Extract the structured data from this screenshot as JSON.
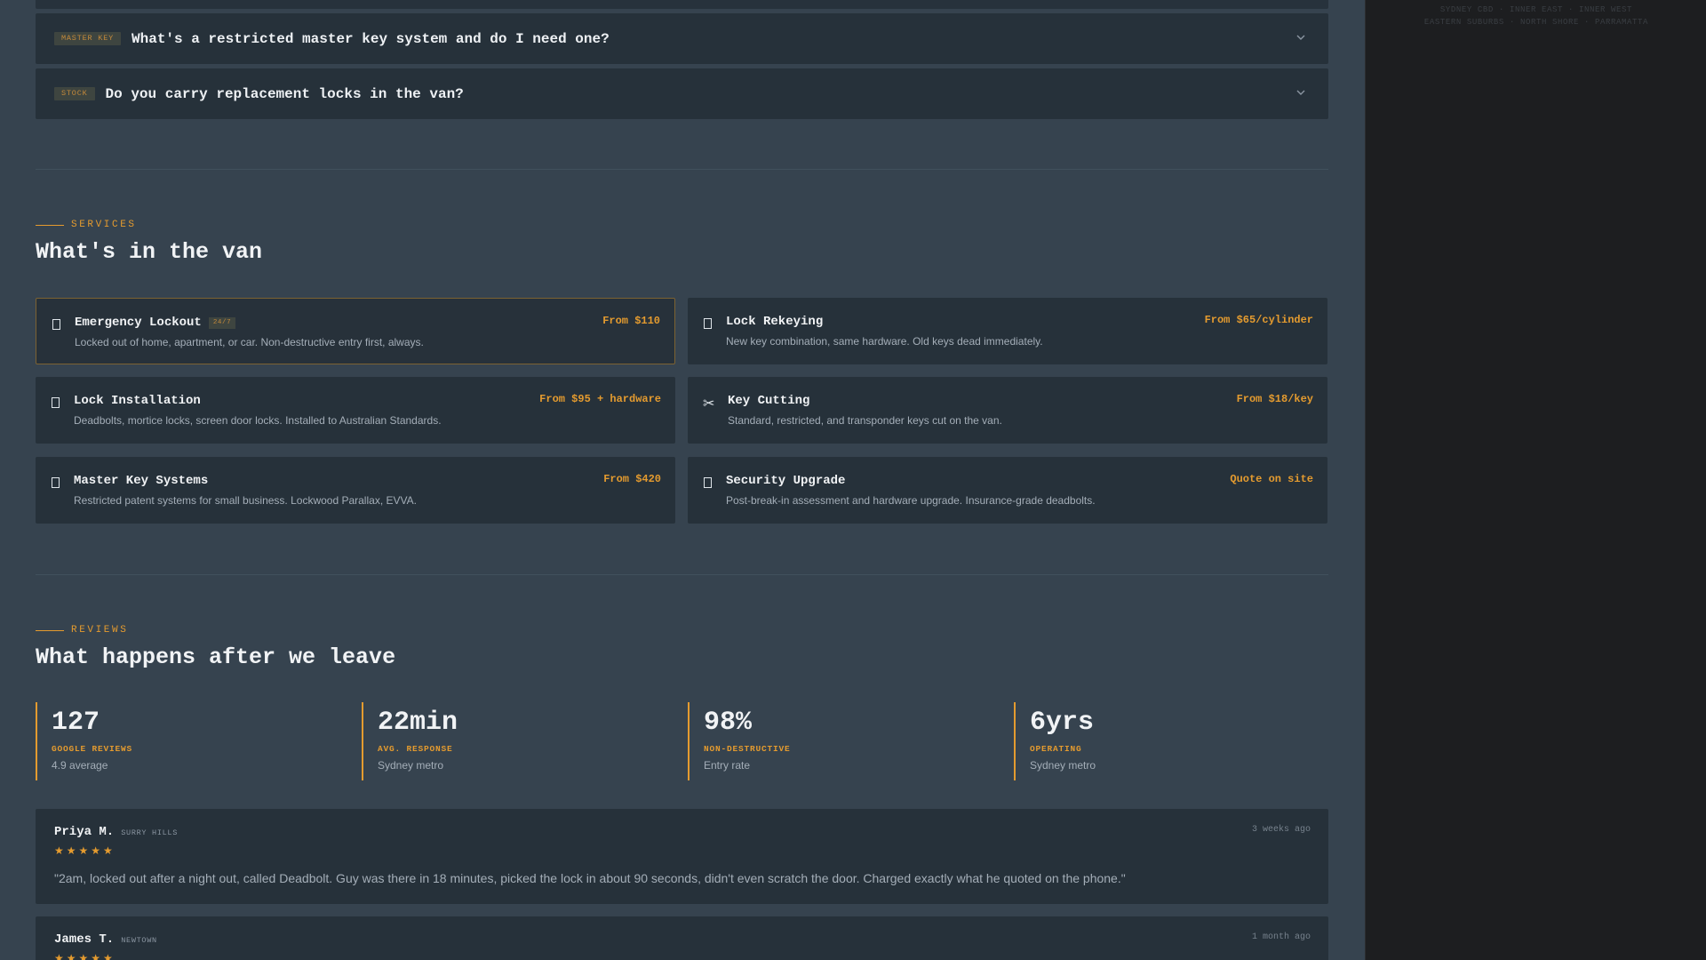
{
  "sidebar": {
    "service_areas": [
      [
        "SYDNEY CBD",
        "INNER EAST",
        "INNER WEST"
      ],
      [
        "EASTERN SUBURBS",
        "NORTH SHORE",
        "PARRAMATTA"
      ]
    ],
    "separator": "·"
  },
  "faq": {
    "items": [
      {
        "tag": "MASTER KEY",
        "question": "What's a restricted master key system and do I need one?"
      },
      {
        "tag": "STOCK",
        "question": "Do you carry replacement locks in the van?"
      }
    ]
  },
  "services": {
    "eyebrow": "SERVICES",
    "heading": "What's in the van",
    "items": [
      {
        "icon": "lock-icon",
        "title": "Emergency Lockout",
        "badge": "24/7",
        "desc": "Locked out of home, apartment, or car. Non-destructive entry first, always.",
        "price": "From $110",
        "active": true
      },
      {
        "icon": "lock-icon",
        "title": "Lock Rekeying",
        "badge": "",
        "desc": "New key combination, same hardware. Old keys dead immediately.",
        "price": "From $65/cylinder",
        "active": false
      },
      {
        "icon": "lock-icon",
        "title": "Lock Installation",
        "badge": "",
        "desc": "Deadbolts, mortice locks, screen door locks. Installed to Australian Standards.",
        "price": "From $95 + hardware",
        "active": false
      },
      {
        "icon": "scissors-icon",
        "title": "Key Cutting",
        "badge": "",
        "desc": "Standard, restricted, and transponder keys cut on the van.",
        "price": "From $18/key",
        "active": false
      },
      {
        "icon": "lock-icon",
        "title": "Master Key Systems",
        "badge": "",
        "desc": "Restricted patent systems for small business. Lockwood Parallax, EVVA.",
        "price": "From $420",
        "active": false
      },
      {
        "icon": "lock-icon",
        "title": "Security Upgrade",
        "badge": "",
        "desc": "Post-break-in assessment and hardware upgrade. Insurance-grade deadbolts.",
        "price": "Quote on site",
        "active": false
      }
    ]
  },
  "reviews": {
    "eyebrow": "REVIEWS",
    "heading": "What happens after we leave",
    "stats": [
      {
        "value": "127",
        "label": "GOOGLE REVIEWS",
        "sub": "4.9 average"
      },
      {
        "value": "22min",
        "label": "AVG. RESPONSE",
        "sub": "Sydney metro"
      },
      {
        "value": "98%",
        "label": "NON-DESTRUCTIVE",
        "sub": "Entry rate"
      },
      {
        "value": "6yrs",
        "label": "OPERATING",
        "sub": "Sydney metro"
      }
    ],
    "items": [
      {
        "name": "Priya M.",
        "suburb": "SURRY HILLS",
        "time": "3 weeks ago",
        "stars": "★★★★★",
        "rating": 5,
        "text": "\"2am, locked out after a night out, called Deadbolt. Guy was there in 18 minutes, picked the lock in about 90 seconds, didn't even scratch the door. Charged exactly what he quoted on the phone.\""
      },
      {
        "name": "James T.",
        "suburb": "NEWTOWN",
        "time": "1 month ago",
        "stars": "★★★★★",
        "rating": 5,
        "text": ""
      }
    ]
  },
  "colors": {
    "accent": "#e49b2f",
    "panel": "#26313a",
    "background": "#36434f",
    "sidebar": "#1d1e20"
  }
}
